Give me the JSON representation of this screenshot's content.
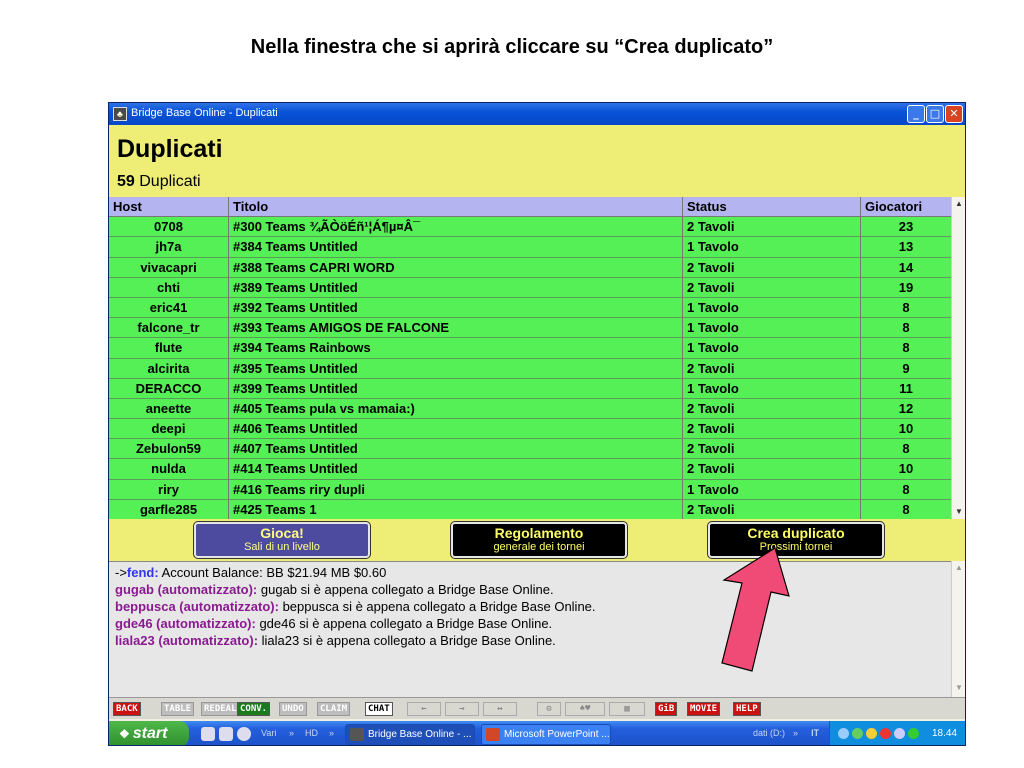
{
  "slide": {
    "title": "Nella finestra che si aprirà cliccare su “Crea duplicato”"
  },
  "window": {
    "title": "Bridge Base Online - Duplicati",
    "icon_glyph": "♣",
    "controls": {
      "minimize": "_",
      "maximize": "□",
      "close": "✕"
    }
  },
  "header": {
    "title": "Duplicati",
    "count": "59",
    "count_label": "Duplicati"
  },
  "table": {
    "columns": [
      "Host",
      "Titolo",
      "Status",
      "Giocatori"
    ],
    "rows": [
      {
        "host": "0708",
        "title": "#300 Teams ¾ÃÒöÉñ¹¦Á¶µ¤Â¯",
        "status": "2 Tavoli",
        "players": "23"
      },
      {
        "host": "jh7a",
        "title": "#384 Teams Untitled",
        "status": "1 Tavolo",
        "players": "13"
      },
      {
        "host": "vivacapri",
        "title": "#388 Teams CAPRI     WORD",
        "status": "2 Tavoli",
        "players": "14"
      },
      {
        "host": "chti",
        "title": "#389 Teams Untitled",
        "status": "2 Tavoli",
        "players": "19"
      },
      {
        "host": "eric41",
        "title": "#392 Teams Untitled",
        "status": "1 Tavolo",
        "players": "8"
      },
      {
        "host": "falcone_tr",
        "title": "#393 Teams AMIGOS DE FALCONE",
        "status": "1 Tavolo",
        "players": "8"
      },
      {
        "host": "flute",
        "title": "#394 Teams Rainbows",
        "status": "1 Tavolo",
        "players": "8"
      },
      {
        "host": "alcirita",
        "title": "#395 Teams Untitled",
        "status": "2 Tavoli",
        "players": "9"
      },
      {
        "host": "DERACCO",
        "title": "#399 Teams Untitled",
        "status": "1 Tavolo",
        "players": "11"
      },
      {
        "host": "aneette",
        "title": "#405 Teams pula vs mamaia:)",
        "status": "2 Tavoli",
        "players": "12"
      },
      {
        "host": "deepi",
        "title": "#406 Teams Untitled",
        "status": "2 Tavoli",
        "players": "10"
      },
      {
        "host": "Zebulon59",
        "title": "#407 Teams Untitled",
        "status": "2 Tavoli",
        "players": "8"
      },
      {
        "host": "nulda",
        "title": "#414 Teams Untitled",
        "status": "2 Tavoli",
        "players": "10"
      },
      {
        "host": "riry",
        "title": "#416 Teams riry dupli",
        "status": "1 Tavolo",
        "players": "8"
      },
      {
        "host": "garfle285",
        "title": "#425 Teams 1",
        "status": "2 Tavoli",
        "players": "8"
      }
    ]
  },
  "buttons": {
    "gioca": {
      "label": "Gioca!",
      "sub": "Sali di un livello"
    },
    "regolamento": {
      "label": "Regolamento",
      "sub": "generale dei tornei"
    },
    "crea": {
      "label": "Crea duplicato",
      "sub": "Prossimi tornei"
    }
  },
  "chat": {
    "lines": [
      {
        "prefix": "->",
        "who": "fend:",
        "text": " Account Balance: BB $21.94  MB $0.60"
      },
      {
        "who": "gugab (automatizzato):",
        "text": " gugab si è appena collegato a Bridge Base Online."
      },
      {
        "who": "beppusca (automatizzato):",
        "text": " beppusca si è appena collegato a Bridge Base Online."
      },
      {
        "who": "gde46 (automatizzato):",
        "text": " gde46 si è appena collegato a Bridge Base Online."
      },
      {
        "who": "liala23 (automatizzato):",
        "text": " liala23 si è appena collegato a Bridge Base Online."
      }
    ]
  },
  "toolbar": {
    "back": "BACK",
    "table": "TABLE",
    "redeal": "REDEAL",
    "conv": "CONV.",
    "undo": "UNDO",
    "claim": "CLAIM",
    "chat": "CHAT",
    "left": "←",
    "right": "→",
    "both": "↔",
    "gib": "GiB",
    "movie": "MOVIE",
    "help": "HELP"
  },
  "taskbar": {
    "start": "start",
    "vari": "Vari",
    "hd": "HD",
    "tasks": [
      "Bridge Base Online - ...",
      "Microsoft PowerPoint ..."
    ],
    "drive": "dati (D:)",
    "lang": "IT",
    "clock": "18.44"
  },
  "colors": {
    "header_bg": "#eeee77",
    "row_bg": "#55f055",
    "head_bg": "#b4b4f0",
    "arrow": "#f04a76"
  }
}
